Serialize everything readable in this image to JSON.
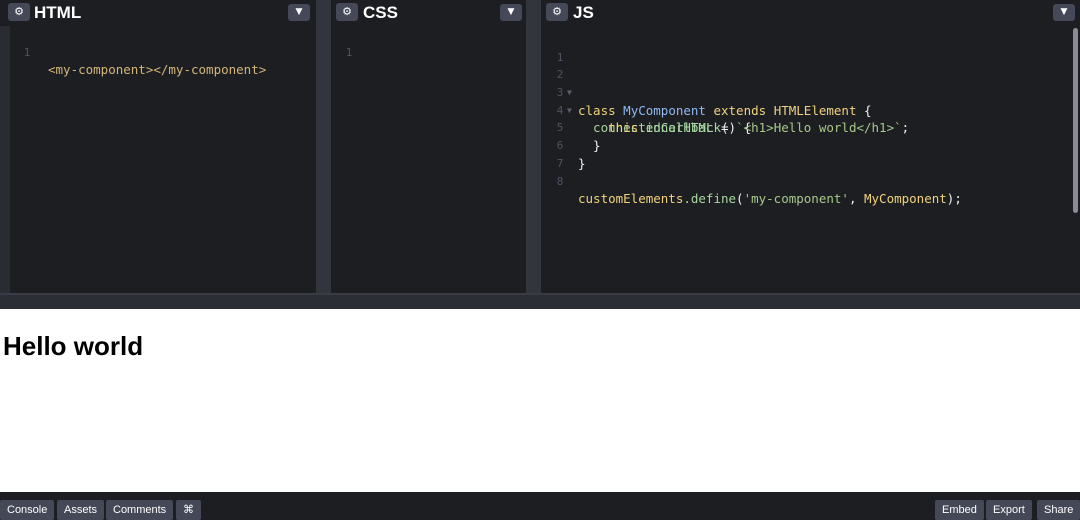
{
  "panes": {
    "html": {
      "title": "HTML",
      "lines": [
        {
          "n": "1",
          "text": "<my-component></my-component>"
        }
      ]
    },
    "css": {
      "title": "CSS",
      "lines": [
        {
          "n": "1"
        }
      ]
    },
    "js": {
      "title": "JS",
      "lines": [
        {
          "n": "1"
        },
        {
          "n": "2",
          "parts": [
            "class",
            " MyComponent",
            " extends",
            " HTMLElement",
            " {"
          ]
        },
        {
          "n": "3",
          "parts": [
            "  connectedCallback",
            "()",
            " {"
          ]
        },
        {
          "n": "4",
          "parts": [
            "    this",
            ".innerHTML",
            " = ",
            "`<h1>Hello world</h1>`",
            ";"
          ]
        },
        {
          "n": "5",
          "parts": [
            "  }"
          ]
        },
        {
          "n": "6",
          "parts": [
            "}"
          ]
        },
        {
          "n": "7"
        },
        {
          "n": "8",
          "parts": [
            "customElements",
            ".define",
            "(",
            "'my-component'",
            ", ",
            "MyComponent",
            ");"
          ]
        }
      ]
    }
  },
  "icons": {
    "settings": "gear-icon",
    "collapse": "chevron-down-icon"
  },
  "preview": {
    "heading": "Hello world"
  },
  "footer": {
    "left": [
      "Console",
      "Assets",
      "Comments",
      "⌘"
    ],
    "right": [
      "Embed",
      "Export",
      "Share"
    ]
  }
}
